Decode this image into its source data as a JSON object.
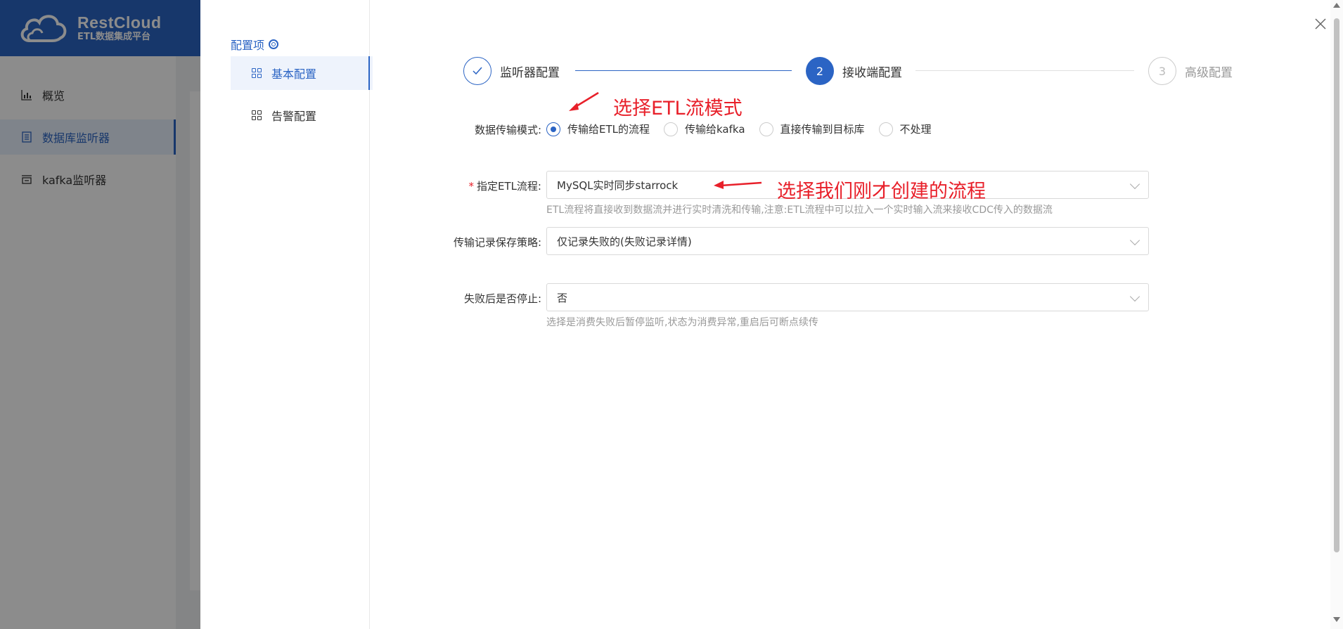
{
  "app": {
    "brand": "RestCloud",
    "subtitle": "ETL数据集成平台"
  },
  "sidebar": {
    "items": [
      {
        "label": "概览",
        "icon": "bar-chart-icon"
      },
      {
        "label": "数据库监听器",
        "icon": "document-icon",
        "active": true
      },
      {
        "label": "kafka监听器",
        "icon": "list-icon"
      }
    ]
  },
  "drawer": {
    "config_title": "配置项",
    "menu": [
      {
        "label": "基本配置",
        "active": true
      },
      {
        "label": "告警配置"
      }
    ],
    "steps": [
      {
        "number": "1",
        "label": "监听器配置",
        "status": "done"
      },
      {
        "number": "2",
        "label": "接收端配置",
        "status": "current"
      },
      {
        "number": "3",
        "label": "高级配置",
        "status": "wait"
      }
    ],
    "form": {
      "mode": {
        "label": "数据传输模式:",
        "options": [
          "传输给ETL的流程",
          "传输给kafka",
          "直接传输到目标库",
          "不处理"
        ],
        "selected": "传输给ETL的流程"
      },
      "flow": {
        "required_mark": "*",
        "label": "指定ETL流程:",
        "value": "MySQL实时同步starrock",
        "hint": "ETL流程将直接收到数据流并进行实时清洗和传输,注意:ETL流程中可以拉入一个实时输入流来接收CDC传入的数据流"
      },
      "record_policy": {
        "label": "传输记录保存策略:",
        "value": "仅记录失败的(失败记录详情)"
      },
      "stop_on_fail": {
        "label": "失败后是否停止:",
        "value": "否",
        "hint": "选择是消费失败后暂停监听,状态为消费异常,重启后可断点续传"
      }
    },
    "annotations": {
      "mode": "选择ETL流模式",
      "flow": "选择我们刚才创建的流程"
    }
  },
  "colors": {
    "primary": "#2b64c4",
    "annotation": "#e8202a",
    "overlay": "rgba(0,0,0,0.45)"
  }
}
